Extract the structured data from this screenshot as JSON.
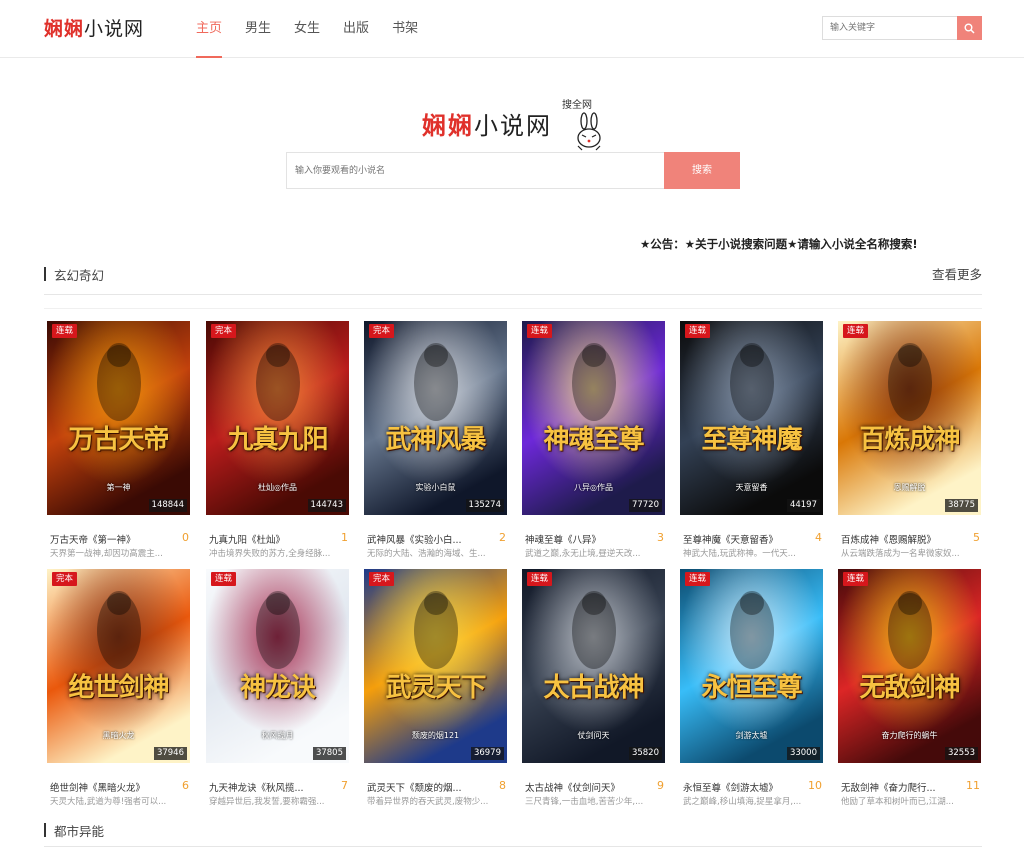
{
  "header": {
    "logo_red": "娴娴",
    "logo_rest": "小说网",
    "nav": [
      "主页",
      "男生",
      "女生",
      "出版",
      "书架"
    ],
    "search_placeholder": "输入关键字"
  },
  "hero": {
    "logo_red": "娴娴",
    "logo_rest": "小说网",
    "logo_sub": "搜全网",
    "search_placeholder": "输入你要观看的小说名",
    "search_button": "搜索"
  },
  "notice": "★公告：★关于小说搜索问题★请输入小说全名称搜索!",
  "sections": [
    {
      "title": "玄幻奇幻",
      "more": "查看更多"
    },
    {
      "title": "都市异能"
    }
  ],
  "books": [
    {
      "status": "连载",
      "count": "148844",
      "name": "万古天帝《第一神》",
      "rank": "0",
      "desc": "天界第一战神,却因功高震主...",
      "cover_text": "万古天帝",
      "author_text": "第一神",
      "colors": [
        "#3a0a04",
        "#c2410c",
        "#f59e0b"
      ]
    },
    {
      "status": "完本",
      "count": "144743",
      "name": "九真九阳《杜灿》",
      "rank": "1",
      "desc": "冲击境界失败的苏方,全身经脉...",
      "cover_text": "九真九阳",
      "author_text": "杜灿◎作品",
      "colors": [
        "#4a0a04",
        "#b91c1c",
        "#fb923c"
      ]
    },
    {
      "status": "完本",
      "count": "135274",
      "name": "武神风暴《实验小白...",
      "rank": "2",
      "desc": "无际的大陆、浩瀚的海域、生...",
      "cover_text": "武神风暴",
      "author_text": "实验小白鼠",
      "colors": [
        "#0f172a",
        "#64748b",
        "#e5e7eb"
      ]
    },
    {
      "status": "连载",
      "count": "77720",
      "name": "神魂至尊《八异》",
      "rank": "3",
      "desc": "武道之巅,永无止境,昼逆天改...",
      "cover_text": "神魂至尊",
      "author_text": "八异◎作品",
      "colors": [
        "#1e1b4b",
        "#6d28d9",
        "#fde68a"
      ]
    },
    {
      "status": "连载",
      "count": "44197",
      "name": "至尊神魔《天意留香》",
      "rank": "4",
      "desc": "神武大陆,玩武称神。一代天...",
      "cover_text": "至尊神魔",
      "author_text": "天意留香",
      "colors": [
        "#0b0b0b",
        "#334155",
        "#94a3b8"
      ]
    },
    {
      "status": "连载",
      "count": "38775",
      "name": "百炼成神《恩赐解脱》",
      "rank": "5",
      "desc": "从云端跌落成为一名卑微家奴...",
      "cover_text": "百炼成神",
      "author_text": "恩赐解脱",
      "colors": [
        "#fef3c7",
        "#d97706",
        "#7c2d12"
      ]
    },
    {
      "status": "完本",
      "count": "37946",
      "name": "绝世剑神《黑暗火龙》",
      "rank": "6",
      "desc": "天灵大陆,武道为尊!强者可以...",
      "cover_text": "绝世剑神",
      "author_text": "黑暗火龙",
      "colors": [
        "#fef3c7",
        "#ea580c",
        "#7c2d12"
      ]
    },
    {
      "status": "连载",
      "count": "37805",
      "name": "九天神龙诀《秋风揽...",
      "rank": "7",
      "desc": "穿越异世后,我发誓,要称霸强...",
      "cover_text": "神龙诀",
      "author_text": "秋风揽月",
      "colors": [
        "#f8fafc",
        "#e2e8f0",
        "#9f1239"
      ]
    },
    {
      "status": "完本",
      "count": "36979",
      "name": "武灵天下《颓废的烟...",
      "rank": "8",
      "desc": "带着异世界的吞天武灵,废物少...",
      "cover_text": "武灵天下",
      "author_text": "颓废的烟121",
      "colors": [
        "#1e3a8a",
        "#f59e0b",
        "#fde047"
      ]
    },
    {
      "status": "连载",
      "count": "35820",
      "name": "太古战神《仗剑问天》",
      "rank": "9",
      "desc": "三尺青锋,一击血地,苦苦少年,...",
      "cover_text": "太古战神",
      "author_text": "仗剑问天",
      "colors": [
        "#111827",
        "#374151",
        "#d1d5db"
      ]
    },
    {
      "status": "连载",
      "count": "33000",
      "name": "永恒至尊《剑游太墟》",
      "rank": "10",
      "desc": "武之巅峰,移山填海,捉星拿月,...",
      "cover_text": "永恒至尊",
      "author_text": "剑游太墟",
      "colors": [
        "#0c4a6e",
        "#38bdf8",
        "#e0f2fe"
      ]
    },
    {
      "status": "连载",
      "count": "32553",
      "name": "无敌剑神《奋力爬行...",
      "rank": "11",
      "desc": "他励了草本和树叶而已,江湖...",
      "cover_text": "无敌剑神",
      "author_text": "奋力爬行的蜗牛",
      "colors": [
        "#450a0a",
        "#dc2626",
        "#facc15"
      ]
    }
  ]
}
